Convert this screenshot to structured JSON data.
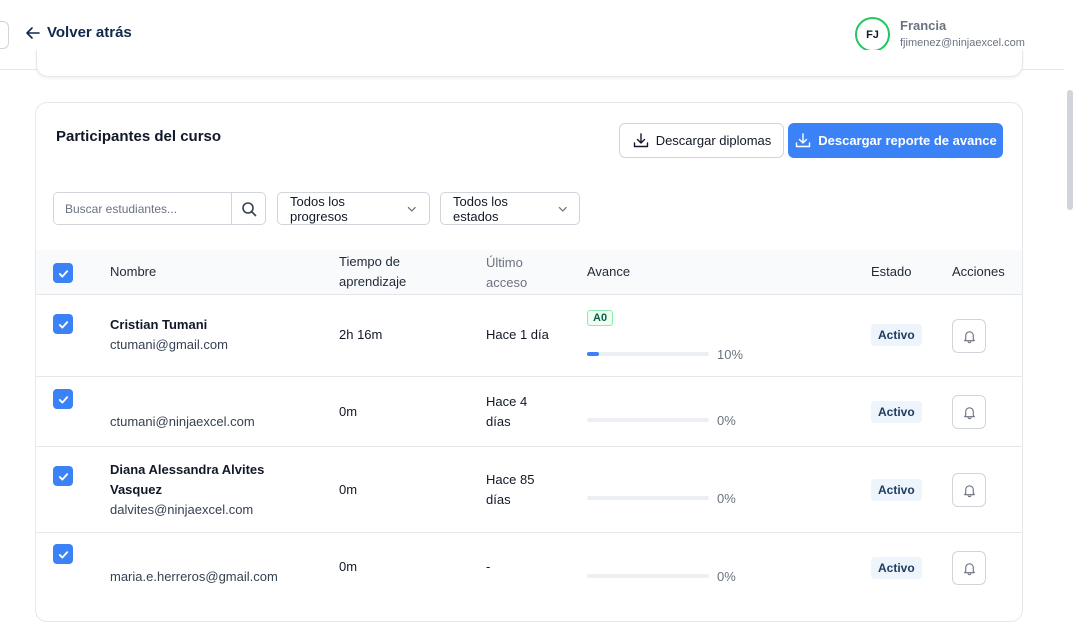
{
  "header": {
    "back_label": "Volver atrás",
    "user": {
      "initials": "FJ",
      "name": "Francia",
      "email": "fjimenez@ninjaexcel.com"
    }
  },
  "card": {
    "title": "Participantes del curso",
    "btn_diplomas": "Descargar diplomas",
    "btn_report": "Descargar reporte de avance",
    "search_placeholder": "Buscar estudiantes...",
    "filter_progress": "Todos los progresos",
    "filter_status": "Todos los estados"
  },
  "table": {
    "headers": {
      "name": "Nombre",
      "time_1": "Tiempo de",
      "time_2": "aprendizaje",
      "last_1": "Último",
      "last_2": "acceso",
      "progress": "Avance",
      "status": "Estado",
      "actions": "Acciones"
    },
    "rows": [
      {
        "name_1": "Cristian Tumani",
        "name_2": "",
        "email": "ctumani@gmail.com",
        "time": "2h 16m",
        "last_1": "Hace 1 día",
        "last_2": "",
        "level": "A0",
        "progress": 10,
        "progress_label": "10%",
        "status": "Activo"
      },
      {
        "name_1": "",
        "name_2": "",
        "email": "ctumani@ninjaexcel.com",
        "time": "0m",
        "last_1": "Hace 4",
        "last_2": "días",
        "level": "",
        "progress": 0,
        "progress_label": "0%",
        "status": "Activo"
      },
      {
        "name_1": "Diana Alessandra Alvites",
        "name_2": "Vasquez",
        "email": "dalvites@ninjaexcel.com",
        "time": "0m",
        "last_1": "Hace 85",
        "last_2": "días",
        "level": "",
        "progress": 0,
        "progress_label": "0%",
        "status": "Activo"
      },
      {
        "name_1": "",
        "name_2": "",
        "email": "maria.e.herreros@gmail.com",
        "time": "0m",
        "last_1": "-",
        "last_2": "",
        "level": "",
        "progress": 0,
        "progress_label": "0%",
        "status": "Activo"
      }
    ]
  }
}
